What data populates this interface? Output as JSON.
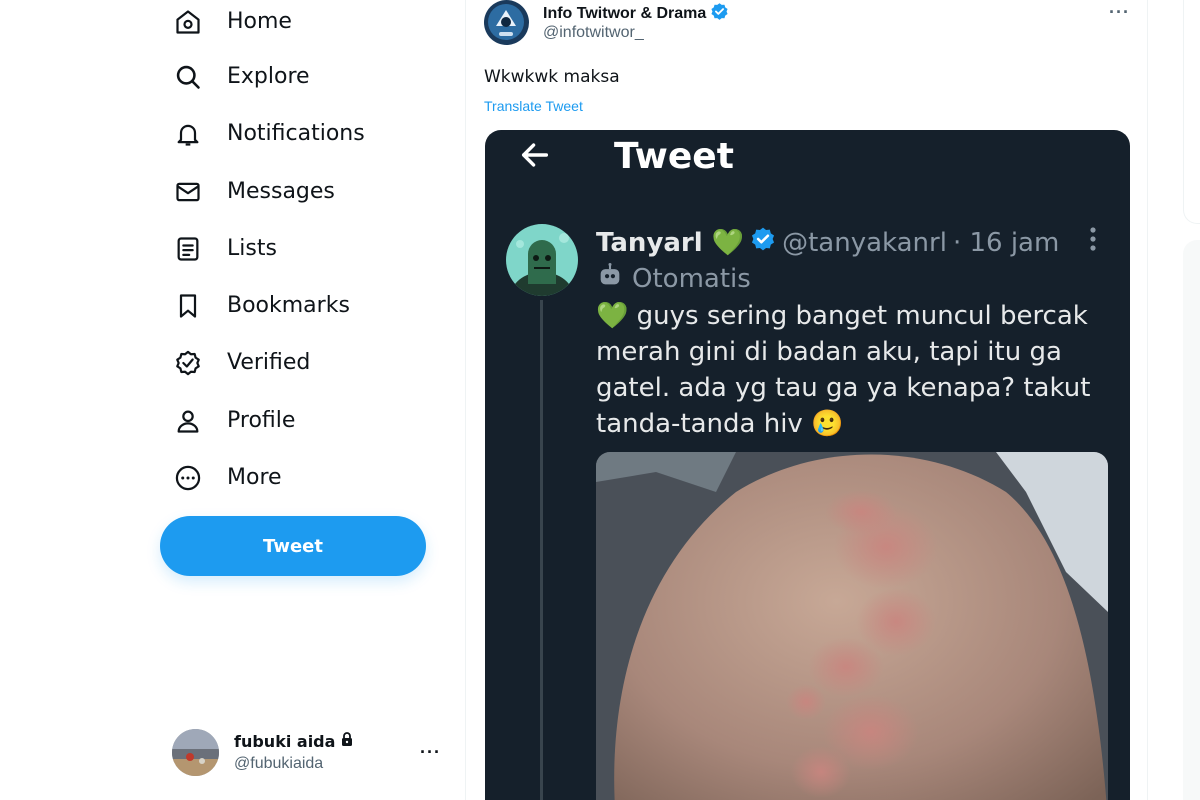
{
  "sidebar": {
    "items": [
      {
        "label": "Home",
        "icon": "home-icon"
      },
      {
        "label": "Explore",
        "icon": "search-icon"
      },
      {
        "label": "Notifications",
        "icon": "bell-icon"
      },
      {
        "label": "Messages",
        "icon": "mail-icon"
      },
      {
        "label": "Lists",
        "icon": "list-icon"
      },
      {
        "label": "Bookmarks",
        "icon": "bookmark-icon"
      },
      {
        "label": "Verified",
        "icon": "verified-badge-icon"
      },
      {
        "label": "Profile",
        "icon": "person-icon"
      },
      {
        "label": "More",
        "icon": "more-circle-icon"
      }
    ],
    "tweet_button": "Tweet",
    "account": {
      "name": "fubuki aida",
      "handle": "@fubukiaida",
      "more": "···"
    }
  },
  "tweet": {
    "author": "Info Twitwor & Drama",
    "handle": "@infotwitwor_",
    "more": "···",
    "text": "Wkwkwk maksa",
    "translate": "Translate Tweet"
  },
  "embedded": {
    "title": "Tweet",
    "author": "Tanyarl 💚",
    "handle": "@tanyakanrl",
    "time": "· 16 jam",
    "automated": "Otomatis",
    "text": "💚 guys sering banget muncul bercak merah gini di badan aku, tapi itu ga gatel. ada yg tau ga ya kenapa? takut tanda-tanda hiv 🥲"
  },
  "colors": {
    "accent": "#1d9bf0",
    "text": "#0f1419",
    "muted": "#536471",
    "dark_bg": "#15202b"
  }
}
